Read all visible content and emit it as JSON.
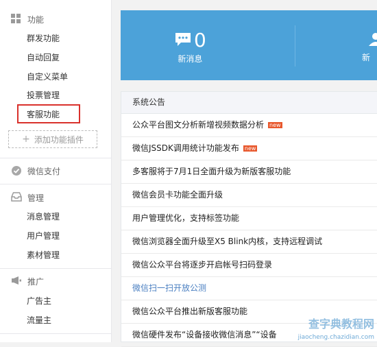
{
  "sidebar": {
    "feature": {
      "title": "功能",
      "items": [
        "群发功能",
        "自动回复",
        "自定义菜单",
        "投票管理",
        "客服功能"
      ],
      "add_plugin": "添加功能插件"
    },
    "payment": {
      "title": "微信支付"
    },
    "manage": {
      "title": "管理",
      "items": [
        "消息管理",
        "用户管理",
        "素材管理"
      ]
    },
    "promote": {
      "title": "推广",
      "items": [
        "广告主",
        "流量主"
      ]
    }
  },
  "stats": {
    "new_messages": {
      "count": "0",
      "label": "新消息"
    },
    "new_users_partial_label": "新"
  },
  "notice": {
    "title": "系统公告",
    "items": [
      {
        "text": "公众平台图文分析新增视频数据分析",
        "badge": "new"
      },
      {
        "text": "微信JSSDK调用统计功能发布",
        "badge": "new"
      },
      {
        "text": "多客服将于7月1日全面升级为新版客服功能"
      },
      {
        "text": "微信会员卡功能全面升级"
      },
      {
        "text": "用户管理优化，支持标签功能"
      },
      {
        "text": "微信浏览器全面升级至X5 Blink内核，支持远程调试"
      },
      {
        "text": "微信公众平台将逐步开启帐号扫码登录"
      },
      {
        "text": "微信扫一扫开放公测"
      },
      {
        "text": "微信公众平台推出新版客服功能"
      },
      {
        "text": "微信硬件发布“设备接收微信消息”“设备"
      }
    ]
  },
  "watermark": {
    "line1": "查字典教程网",
    "line2": "jiaocheng.chazidian.com"
  },
  "colors": {
    "stats_bg": "#4ca2d9",
    "highlight": "#d9302b",
    "link": "#4a7fc1",
    "badge": "#e8582d"
  }
}
